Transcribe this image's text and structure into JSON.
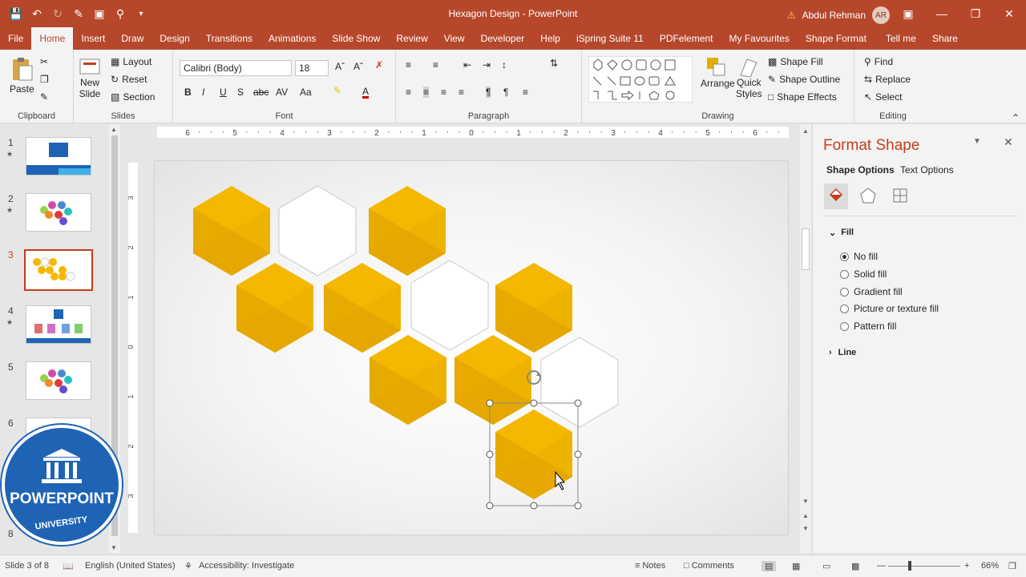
{
  "window": {
    "title": "Hexagon Design  -  PowerPoint",
    "user_name": "Abdul Rehman",
    "user_initials": "AR"
  },
  "tabs": [
    "File",
    "Home",
    "Insert",
    "Draw",
    "Design",
    "Transitions",
    "Animations",
    "Slide Show",
    "Review",
    "View",
    "Developer",
    "Help",
    "iSpring Suite 11",
    "PDFelement",
    "My Favourites",
    "Shape Format",
    "Tell me",
    "Share"
  ],
  "active_tab": "Home",
  "ribbon": {
    "clipboard": {
      "paste": "Paste",
      "label": "Clipboard"
    },
    "slides": {
      "new_slide": "New",
      "new_slide2": "Slide",
      "layout": "Layout",
      "reset": "Reset",
      "section": "Section",
      "label": "Slides"
    },
    "font": {
      "family": "Calibri (Body)",
      "size": "18",
      "label": "Font"
    },
    "paragraph": {
      "label": "Paragraph"
    },
    "drawing": {
      "arrange": "Arrange",
      "quick_styles": "Quick",
      "quick_styles2": "Styles",
      "shape_fill": "Shape Fill",
      "shape_outline": "Shape Outline",
      "shape_effects": "Shape Effects",
      "label": "Drawing"
    },
    "editing": {
      "find": "Find",
      "replace": "Replace",
      "select": "Select",
      "label": "Editing"
    }
  },
  "slides_panel": {
    "numbers": [
      "1",
      "2",
      "3",
      "4",
      "5",
      "6",
      "8"
    ],
    "selected": "3"
  },
  "ruler": {
    "top_labels": [
      "6",
      "5",
      "4",
      "3",
      "2",
      "1",
      "0",
      "1",
      "2",
      "3",
      "4",
      "5",
      "6"
    ],
    "left_labels": [
      "3",
      "2",
      "1",
      "0",
      "1",
      "2",
      "3"
    ]
  },
  "format_pane": {
    "title": "Format Shape",
    "shape_options": "Shape Options",
    "text_options": "Text Options",
    "fill_header": "Fill",
    "fill_options": [
      "No fill",
      "Solid fill",
      "Gradient fill",
      "Picture or texture fill",
      "Pattern fill"
    ],
    "selected_fill": "No fill",
    "line_header": "Line"
  },
  "status": {
    "slide_info": "Slide 3 of 8",
    "language": "English (United States)",
    "accessibility": "Accessibility: Investigate",
    "notes": "Notes",
    "comments": "Comments",
    "zoom": "66%"
  },
  "logo": {
    "text1": "POWERPOINT",
    "text2": "UNIVERSITY"
  },
  "colors": {
    "accent": "#b7472a",
    "hex_fill": "#f5b800",
    "hex_shade": "#e6a800"
  }
}
